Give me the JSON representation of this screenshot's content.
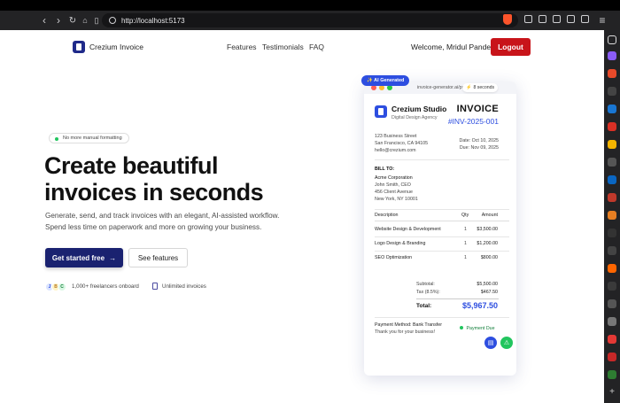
{
  "browser": {
    "url": "http://localhost:5173"
  },
  "nav": {
    "brand": "Crezium Invoice",
    "links": [
      "Features",
      "Testimonials",
      "FAQ"
    ],
    "welcome": "Welcome, Mridul Pandey!",
    "logout": "Logout"
  },
  "hero": {
    "pill": "No more manual formatting",
    "title_line1": "Create beautiful",
    "title_line2": "invoices in seconds",
    "subtitle_line1": "Generate, send, and track invoices with an elegant, AI-assisted workflow.",
    "subtitle_line2": "Spend less time on paperwork and more on growing your business.",
    "cta_primary": "Get started free",
    "cta_arrow": "→",
    "cta_secondary": "See features",
    "avatars": [
      "J",
      "B",
      "C"
    ],
    "freelancers": "1,000+ freelancers onboard",
    "unlimited": "Unlimited invoices"
  },
  "preview": {
    "badge": "✨ AI Generated",
    "url": "invoice-generator.ai/preview",
    "timer": "8 seconds",
    "company": "Crezium Studio",
    "tagline": "Digital Design Agency",
    "doc_title": "INVOICE",
    "number": "#INV-2025-001",
    "address1": "123 Business Street",
    "address2": "San Francisco, CA 94105",
    "email": "hello@crezium.com",
    "date": "Date: Oct 10, 2025",
    "due": "Due: Nov 09, 2025",
    "bill_to_label": "BILL TO:",
    "client": "Acme Corporation",
    "contact": "John Smith, CEO",
    "client_addr1": "456 Client Avenue",
    "client_addr2": "New York, NY 10001",
    "col_description": "Description",
    "col_qty": "Qty",
    "col_amount": "Amount",
    "items": [
      {
        "desc": "Website Design & Development",
        "qty": "1",
        "amount": "$3,500.00"
      },
      {
        "desc": "Logo Design & Branding",
        "qty": "1",
        "amount": "$1,200.00"
      },
      {
        "desc": "SEO Optimization",
        "qty": "1",
        "amount": "$800.00"
      }
    ],
    "subtotal_label": "Subtotal:",
    "subtotal": "$5,500.00",
    "tax_label": "Tax (8.5%):",
    "tax": "$467.50",
    "total_label": "Total:",
    "total": "$5,967.50",
    "payment": "Payment Method: Bank Transfer",
    "thanks": "Thank you for your business!",
    "status": "Payment Due"
  },
  "colors": {
    "brand_navy": "#1a2270",
    "accent_blue": "#2d4ee0",
    "logout_red": "#c8141a",
    "status_green": "#22c55e"
  }
}
